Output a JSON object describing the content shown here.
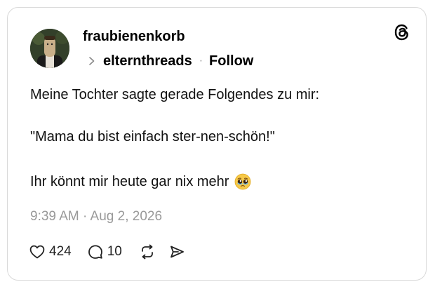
{
  "post": {
    "author": "fraubienenkorb",
    "replying_to": "elternthreads",
    "separator": "·",
    "follow_label": "Follow",
    "lines": [
      "Meine Tochter sagte gerade Folgendes zu mir:",
      "\"Mama du bist einfach ster-nen-schön!\"",
      "Ihr könnt mir heute gar nix mehr"
    ],
    "emoji": "pleading-face-with-tears",
    "timestamp": "9:39 AM · Aug 2, 2026"
  },
  "actions": {
    "likes": "424",
    "replies": "10"
  },
  "icons": {
    "brand": "threads-logo-icon",
    "like": "heart-icon",
    "reply": "comment-bubble-icon",
    "repost": "repost-icon",
    "share": "send-icon",
    "chevron": "chevron-right-icon"
  },
  "colors": {
    "text": "#000000",
    "muted": "#999999",
    "border": "#d9d9d9"
  }
}
